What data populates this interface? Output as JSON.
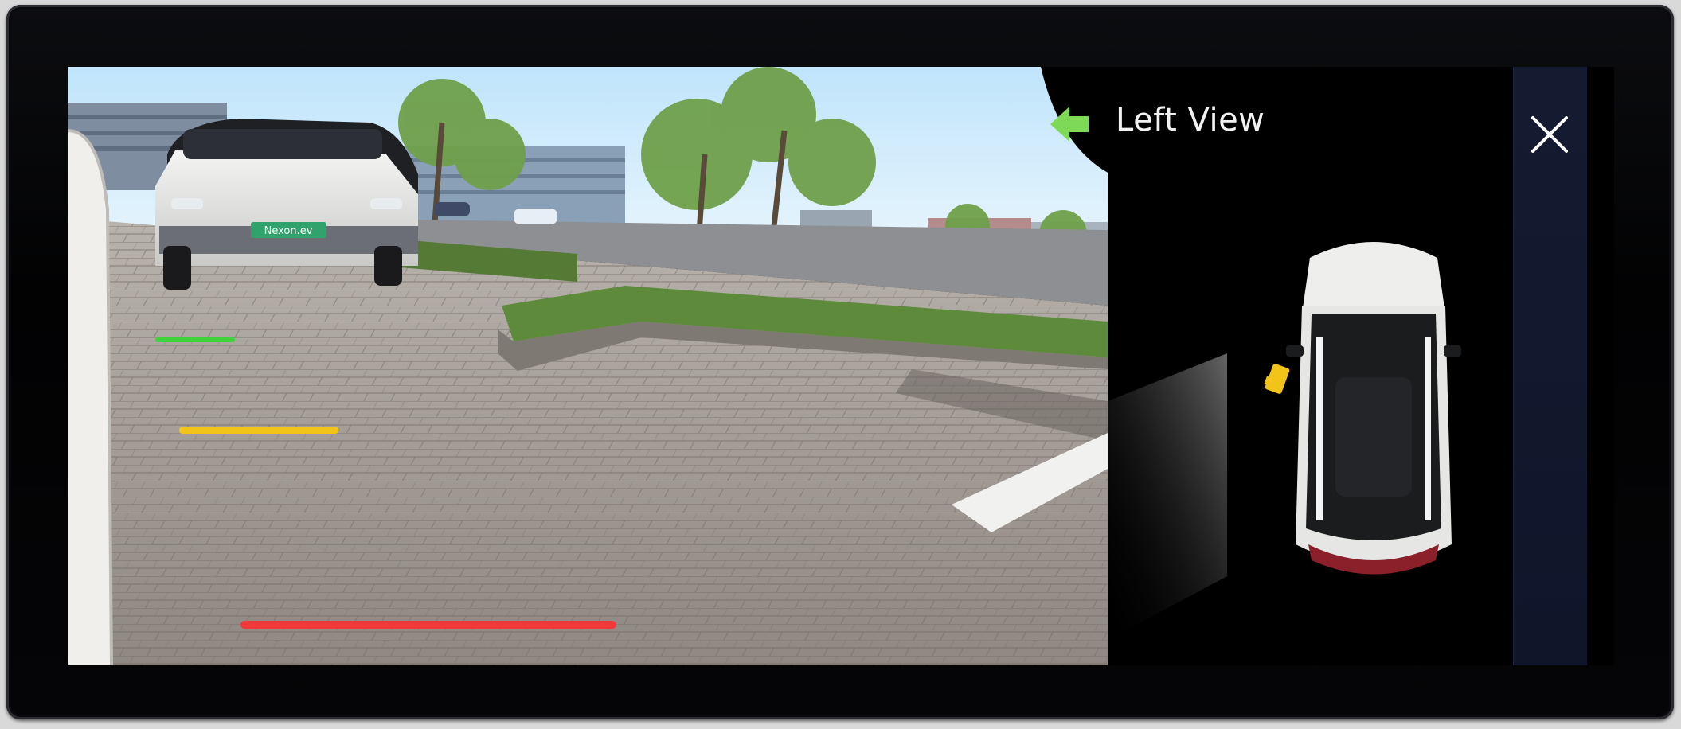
{
  "header": {
    "title": "Left View"
  },
  "icons": {
    "direction": "left-arrow-icon",
    "close": "close-icon",
    "camera_marker": "camera-marker-icon"
  },
  "camera": {
    "vehicle_plate": "Nexon.ev",
    "guide_lines": [
      "green",
      "yellow",
      "red"
    ]
  },
  "colors": {
    "accent_green": "#7ed957",
    "guide_green": "#3fd23a",
    "guide_yellow": "#f2c318",
    "guide_red": "#f03a3a",
    "side_strip": "#141a30",
    "text": "#f2f2f2"
  }
}
